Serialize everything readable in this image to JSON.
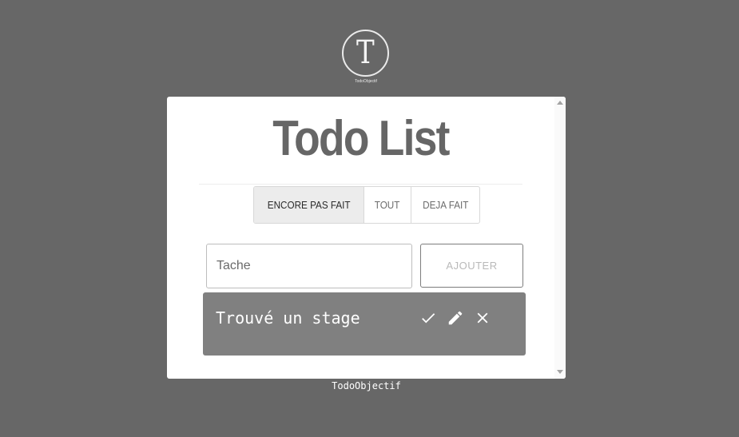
{
  "logo": {
    "letter": "T",
    "caption": "TodoObjectif"
  },
  "card": {
    "title": "Todo List"
  },
  "filters": {
    "tabs": [
      {
        "label": "ENCORE PAS FAIT",
        "active": true
      },
      {
        "label": "TOUT",
        "active": false
      },
      {
        "label": "DEJA FAIT",
        "active": false
      }
    ]
  },
  "form": {
    "placeholder": "Tache",
    "add_label": "AJOUTER"
  },
  "todos": [
    {
      "text": "Trouvé un stage"
    }
  ],
  "footer": {
    "text": "TodoObjectif"
  },
  "colors": {
    "background": "#676767",
    "card": "#ffffff",
    "title": "#666666",
    "item": "#808080",
    "active_tab": "#ececec"
  }
}
